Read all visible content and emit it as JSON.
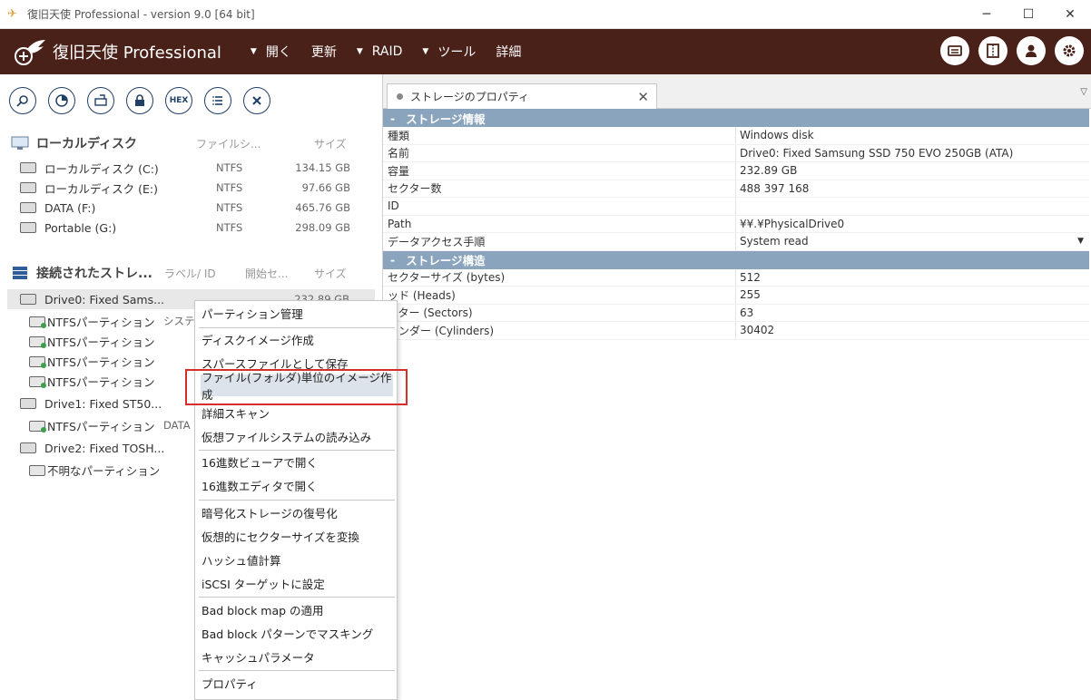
{
  "window": {
    "title": "復旧天使 Professional - version 9.0 [64 bit]",
    "minimize": "─",
    "maximize": "☐",
    "close": "✕"
  },
  "header": {
    "brand": "復旧天使 Professional",
    "menu": [
      {
        "label": "開く",
        "arrow": "▼"
      },
      {
        "label": "更新",
        "arrow": ""
      },
      {
        "label": "RAID",
        "arrow": "▼"
      },
      {
        "label": "ツール",
        "arrow": "▼"
      },
      {
        "label": "詳細",
        "arrow": ""
      }
    ]
  },
  "toolbar": {
    "hex_label": "HEX"
  },
  "local": {
    "title": "ローカルディスク",
    "col_fs": "ファイルシ...",
    "col_size": "サイズ",
    "items": [
      {
        "name": "ローカルディスク (C:)",
        "fs": "NTFS",
        "size": "134.15 GB"
      },
      {
        "name": "ローカルディスク (E:)",
        "fs": "NTFS",
        "size": "97.66 GB"
      },
      {
        "name": "DATA (F:)",
        "fs": "NTFS",
        "size": "465.76 GB"
      },
      {
        "name": "Portable (G:)",
        "fs": "NTFS",
        "size": "298.09 GB"
      }
    ]
  },
  "connected": {
    "title": "接続されたストレ...",
    "col_label": "ラベル/ ID",
    "col_start": "開始セ...",
    "col_size": "サイズ",
    "items": [
      {
        "name": "Drive0: Fixed Sams...",
        "label": "",
        "size": "232.89 GB"
      },
      {
        "name": "NTFSパーティション",
        "label": "システ",
        "size": ""
      },
      {
        "name": "NTFSパーティション",
        "label": "",
        "size": ""
      },
      {
        "name": "NTFSパーティション",
        "label": "",
        "size": ""
      },
      {
        "name": "NTFSパーティション",
        "label": "",
        "size": ""
      },
      {
        "name": "Drive1: Fixed ST50...",
        "label": "",
        "size": ""
      },
      {
        "name": "NTFSパーティション",
        "label": "DATA",
        "size": ""
      },
      {
        "name": "Drive2: Fixed TOSH...",
        "label": "",
        "size": ""
      },
      {
        "name": "不明なパーティション",
        "label": "",
        "size": ""
      }
    ]
  },
  "context_menu": {
    "items": [
      "パーティション管理",
      "ディスクイメージ作成",
      "スパースファイルとして保存",
      "ファイル(フォルダ)単位のイメージ作成",
      "詳細スキャン",
      "仮想ファイルシステムの読み込み",
      "16進数ビューアで開く",
      "16進数エディタで開く",
      "暗号化ストレージの復号化",
      "仮想的にセクターサイズを変換",
      "ハッシュ値計算",
      "iSCSI ターゲットに設定",
      "Bad block map の適用",
      "Bad block パターンでマスキング",
      "キャッシュパラメータ",
      "プロパティ"
    ],
    "highlighted_index": 3
  },
  "tab": {
    "label": "ストレージのプロパティ",
    "close": "✕",
    "menu": "▽"
  },
  "properties": {
    "group1": {
      "title": "ストレージ情報",
      "toggle": "-"
    },
    "group1_rows": [
      {
        "key": "種類",
        "value": "Windows disk"
      },
      {
        "key": "名前",
        "value": "Drive0: Fixed Samsung SSD 750 EVO 250GB (ATA)"
      },
      {
        "key": "容量",
        "value": "232.89 GB"
      },
      {
        "key": "セクター数",
        "value": "488 397 168"
      },
      {
        "key": "ID",
        "value": ""
      },
      {
        "key": "Path",
        "value": "¥¥.¥PhysicalDrive0"
      },
      {
        "key": "データアクセス手順",
        "value": "System read",
        "dropdown": "▼"
      }
    ],
    "group2": {
      "title": "ストレージ構造",
      "toggle": "-"
    },
    "group2_rows": [
      {
        "key": "セクターサイズ (bytes)",
        "value": "512"
      },
      {
        "key": "ッド (Heads)",
        "value": "255"
      },
      {
        "key": "クター (Sectors)",
        "value": "63"
      },
      {
        "key": "リンダー (Cylinders)",
        "value": "30402"
      }
    ]
  },
  "colors": {
    "header_bg": "#4a2119",
    "group_bg": "#8aa4bd",
    "highlight_border": "#d62d2d",
    "icon_blue": "#1f3f66"
  }
}
